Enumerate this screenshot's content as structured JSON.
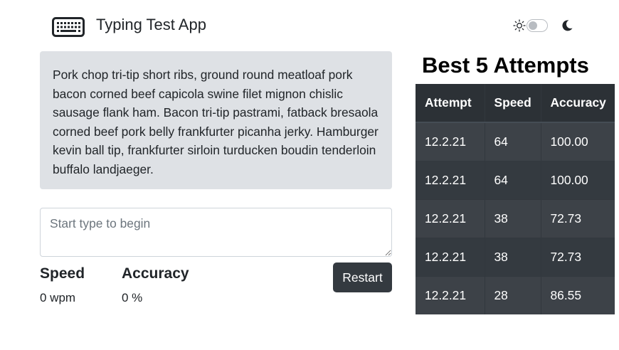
{
  "header": {
    "app_title": "Typing Test App",
    "logo_icon": "keyboard-icon",
    "theme_toggle": {
      "sun_icon": "sun-icon",
      "moon_icon": "moon-icon",
      "dark_mode": false
    }
  },
  "passage": {
    "text": "Pork chop tri-tip short ribs, ground round meatloaf pork bacon corned beef capicola swine filet mignon chislic sausage flank ham. Bacon tri-tip pastrami, fatback bresaola corned beef pork belly frankfurter picanha jerky. Hamburger kevin ball tip, frankfurter sirloin turducken boudin tenderloin buffalo landjaeger."
  },
  "input": {
    "placeholder": "Start type to begin",
    "value": ""
  },
  "stats": {
    "speed_label": "Speed",
    "speed_value": "0 wpm",
    "accuracy_label": "Accuracy",
    "accuracy_value": "0 %"
  },
  "restart_label": "Restart",
  "best_attempts": {
    "title": "Best 5 Attempts",
    "columns": [
      "Attempt",
      "Speed",
      "Accuracy"
    ],
    "rows": [
      [
        "12.2.21",
        "64",
        "100.00"
      ],
      [
        "12.2.21",
        "64",
        "100.00"
      ],
      [
        "12.2.21",
        "38",
        "72.73"
      ],
      [
        "12.2.21",
        "38",
        "72.73"
      ],
      [
        "12.2.21",
        "28",
        "86.55"
      ]
    ]
  },
  "colors": {
    "passage_bg": "#dee1e5",
    "button_bg": "#343a40",
    "table_dark": "#343a40",
    "table_stripe": "#3d4248"
  }
}
